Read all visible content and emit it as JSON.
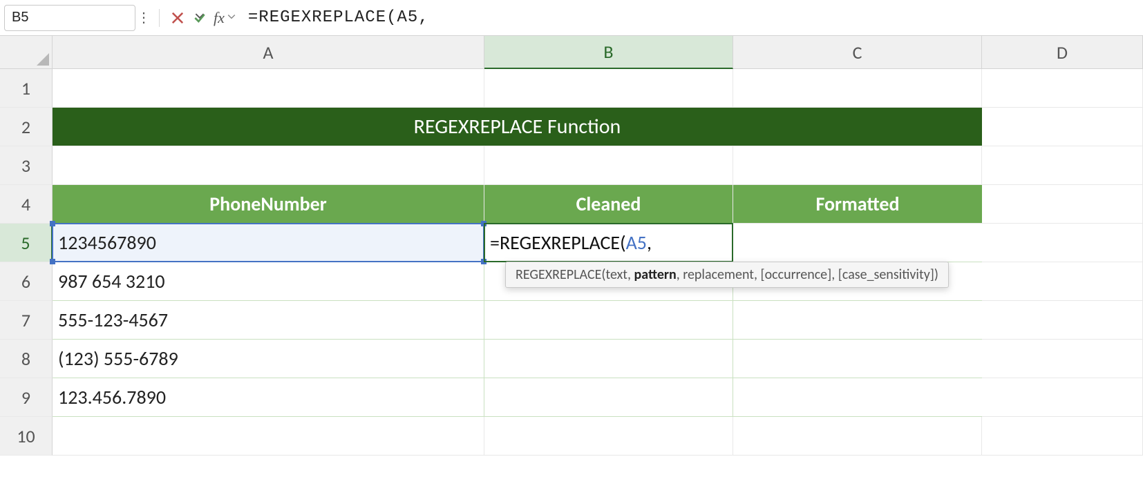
{
  "formula_bar": {
    "name_box": "B5",
    "formula_text_prefix": "=REGEXREPLACE(",
    "formula_text_ref": "A5",
    "formula_text_suffix": ","
  },
  "columns": [
    "A",
    "B",
    "C",
    "D"
  ],
  "rows": [
    "1",
    "2",
    "3",
    "4",
    "5",
    "6",
    "7",
    "8",
    "9",
    "10"
  ],
  "banner": "REGEXREPLACE Function",
  "headers": {
    "A": "PhoneNumber",
    "B": "Cleaned",
    "C": "Formatted"
  },
  "data": {
    "A5": "1234567890",
    "A6": "987 654 3210",
    "A7": "555-123-4567",
    "A8": "(123) 555-6789",
    "A9": "123.456.7890"
  },
  "editing": {
    "prefix": "=REGEXREPLACE(",
    "ref": "A5",
    "suffix": ","
  },
  "tooltip": {
    "fn": "REGEXREPLACE",
    "p_open": "(",
    "a1": "text",
    "sep": ", ",
    "a2": "pattern",
    "a3": "replacement",
    "a4": "[occurrence]",
    "a5": "[case_sensitivity]",
    "p_close": ")"
  }
}
